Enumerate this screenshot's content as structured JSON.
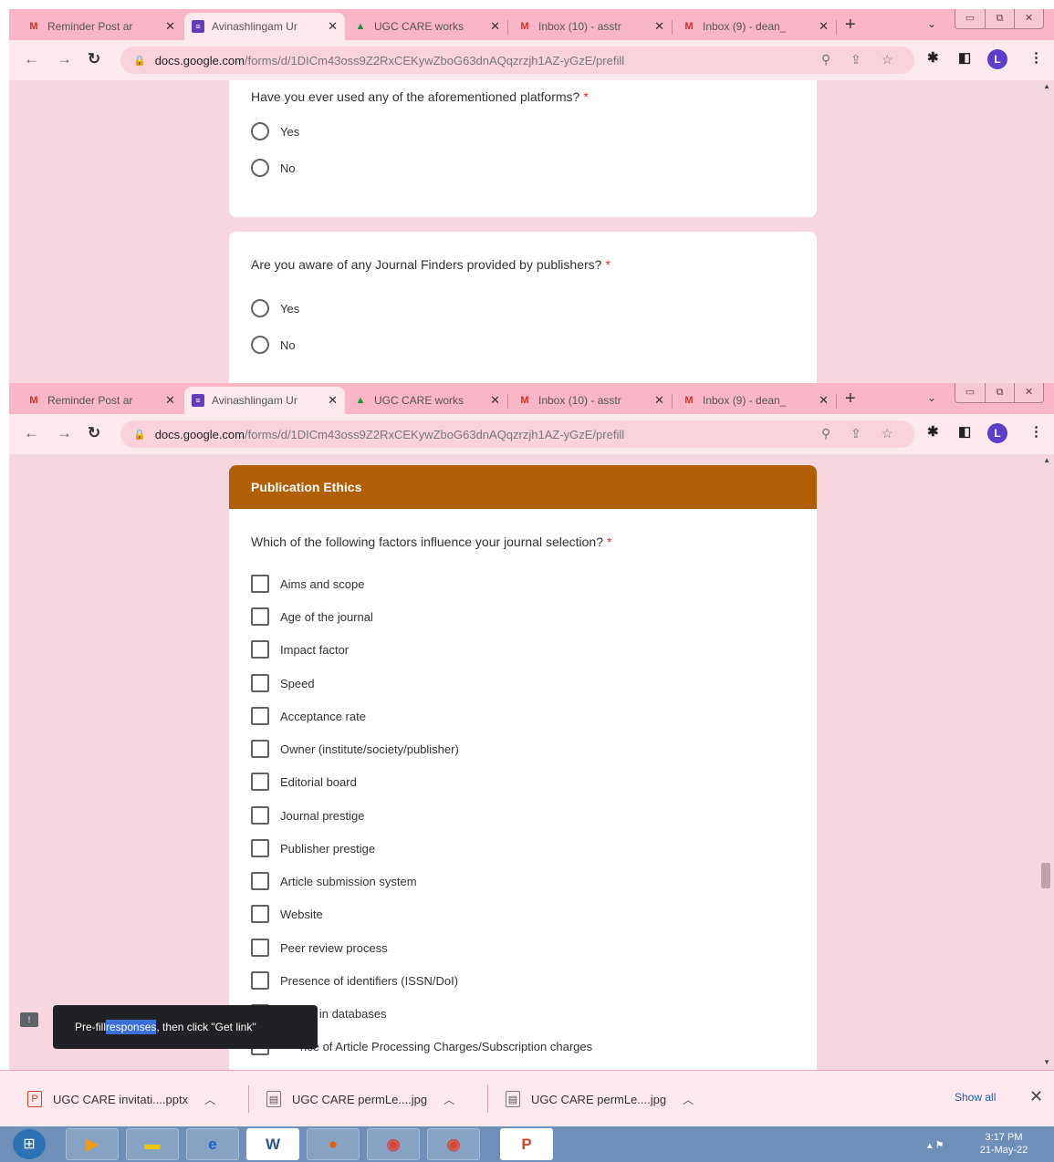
{
  "browser": {
    "tabs": [
      {
        "label": "Reminder Post ar",
        "icon": "gmail-icon"
      },
      {
        "label": "Avinashlingam Ur",
        "icon": "google-forms-icon"
      },
      {
        "label": "UGC CARE works",
        "icon": "google-drive-icon"
      },
      {
        "label": "Inbox (10) - asstr",
        "icon": "gmail-icon"
      },
      {
        "label": "Inbox (9) - dean_",
        "icon": "gmail-icon"
      }
    ],
    "new_tab": "+",
    "url_host": "docs.google.com",
    "url_path": "/forms/d/1DICm43oss9Z2RxCEKywZboG63dnAQqzrzjh1AZ-yGzE/prefill",
    "profile_initial": "L"
  },
  "form": {
    "q1": {
      "text": "Have you ever used any of the aforementioned platforms?",
      "required_mark": "*",
      "options": [
        "Yes",
        "No"
      ]
    },
    "q2": {
      "text": "Are you aware of any Journal Finders provided by publishers?",
      "required_mark": "*",
      "options": [
        "Yes",
        "No"
      ]
    },
    "section_title": "Publication Ethics",
    "accent_color": "#b05f04",
    "q3": {
      "text": "Which of the following factors influence your journal selection?",
      "required_mark": "*",
      "options": [
        "Aims and scope",
        "Age of the journal",
        "Impact factor",
        "Speed",
        "Acceptance rate",
        "Owner (institute/society/publisher)",
        "Editorial board",
        "Journal prestige",
        "Publisher prestige",
        "Article submission system",
        "Website",
        "Peer review process",
        "Presence of identifiers (ISSN/DoI)",
        "d in databases",
        "nce of Article Processing Charges/Subscription charges"
      ]
    }
  },
  "snackbar": {
    "prefix": "Pre-fill ",
    "highlight": "responses",
    "suffix": ", then click \"Get link\""
  },
  "downloads": {
    "items": [
      {
        "label": "UGC CARE invitati....pptx"
      },
      {
        "label": "UGC CARE permLe....jpg"
      },
      {
        "label": "UGC CARE permLe....jpg"
      }
    ],
    "show_all": "Show all"
  },
  "taskbar": {
    "apps": [
      "ie-icon",
      "file-explorer-icon",
      "internet-explorer-icon",
      "word-icon",
      "firefox-icon",
      "chrome-icon",
      "chrome-profile-icon",
      "powerpoint-icon"
    ],
    "word_glyph": "W",
    "ppt_glyph": "P",
    "time": "3:17 PM",
    "date": "21-May-22"
  }
}
